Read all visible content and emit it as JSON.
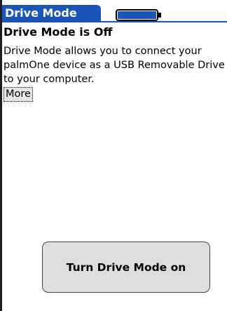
{
  "window": {
    "title": "Drive Mode"
  },
  "status": {
    "battery_icon": "battery-icon",
    "battery_level": 1.0,
    "battery_color": "#1c55b8"
  },
  "content": {
    "heading": "Drive Mode is Off",
    "description": "Drive Mode allows you to connect your palmOne device as a USB Removable Drive to your computer.",
    "more_label": "More"
  },
  "action": {
    "button_label": "Turn Drive Mode on"
  },
  "colors": {
    "accent": "#1c55b8",
    "button_fill": "#dedede",
    "background": "#ffffff"
  }
}
